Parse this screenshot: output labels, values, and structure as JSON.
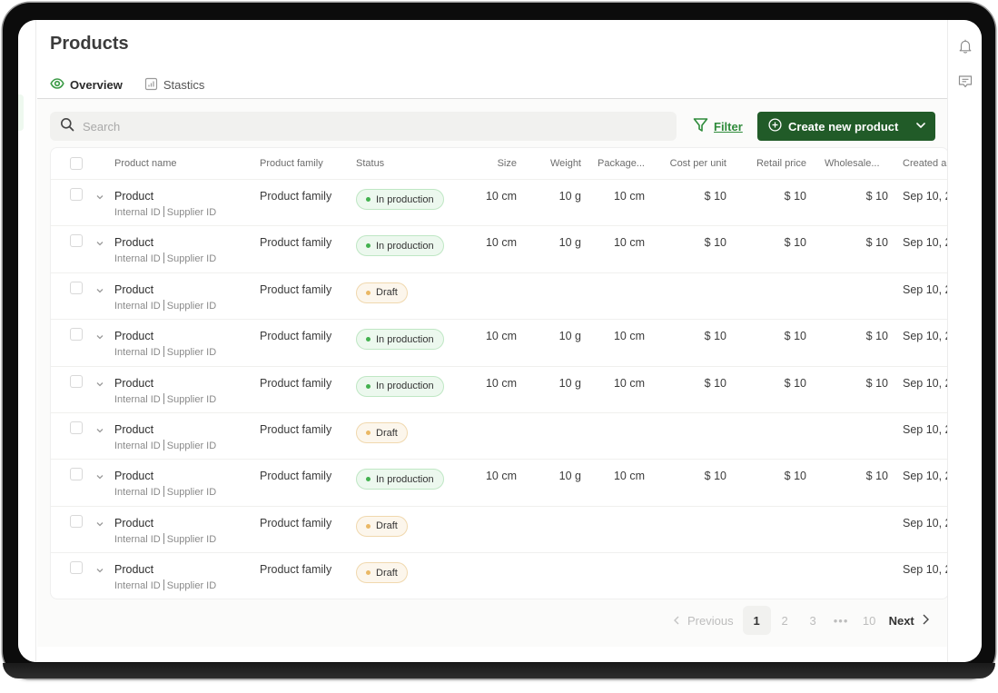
{
  "page": {
    "title": "Products"
  },
  "tabs": [
    {
      "label": "Overview",
      "icon": "eye-icon",
      "active": true
    },
    {
      "label": "Stastics",
      "icon": "bar-chart-icon",
      "active": false
    }
  ],
  "toolbar": {
    "search_placeholder": "Search",
    "search_value": "",
    "filter_label": "Filter",
    "create_label": "Create new product"
  },
  "right_rail": {
    "icons": [
      "bell-icon",
      "message-icon"
    ]
  },
  "table": {
    "columns": [
      "Product name",
      "Product family",
      "Status",
      "Size",
      "Weight",
      "Package...",
      "Cost per unit",
      "Retail price",
      "Wholesale...",
      "Created a"
    ],
    "rows": [
      {
        "name": "Product",
        "internal_id": "Internal ID",
        "supplier_id": "Supplier ID",
        "family": "Product family",
        "status": "In production",
        "size": "10 cm",
        "weight": "10 g",
        "package": "10 cm",
        "cost": "$ 10",
        "retail": "$ 10",
        "wholesale": "$ 10",
        "created": "Sep 10, 2"
      },
      {
        "name": "Product",
        "internal_id": "Internal ID",
        "supplier_id": "Supplier ID",
        "family": "Product family",
        "status": "In production",
        "size": "10 cm",
        "weight": "10 g",
        "package": "10 cm",
        "cost": "$ 10",
        "retail": "$ 10",
        "wholesale": "$ 10",
        "created": "Sep 10, 2"
      },
      {
        "name": "Product",
        "internal_id": "Internal ID",
        "supplier_id": "Supplier ID",
        "family": "Product family",
        "status": "Draft",
        "size": "",
        "weight": "",
        "package": "",
        "cost": "",
        "retail": "",
        "wholesale": "",
        "created": "Sep 10, 2"
      },
      {
        "name": "Product",
        "internal_id": "Internal ID",
        "supplier_id": "Supplier ID",
        "family": "Product family",
        "status": "In production",
        "size": "10 cm",
        "weight": "10 g",
        "package": "10 cm",
        "cost": "$ 10",
        "retail": "$ 10",
        "wholesale": "$ 10",
        "created": "Sep 10, 2"
      },
      {
        "name": "Product",
        "internal_id": "Internal ID",
        "supplier_id": "Supplier ID",
        "family": "Product family",
        "status": "In production",
        "size": "10 cm",
        "weight": "10 g",
        "package": "10 cm",
        "cost": "$ 10",
        "retail": "$ 10",
        "wholesale": "$ 10",
        "created": "Sep 10, 2"
      },
      {
        "name": "Product",
        "internal_id": "Internal ID",
        "supplier_id": "Supplier ID",
        "family": "Product family",
        "status": "Draft",
        "size": "",
        "weight": "",
        "package": "",
        "cost": "",
        "retail": "",
        "wholesale": "",
        "created": "Sep 10, 2"
      },
      {
        "name": "Product",
        "internal_id": "Internal ID",
        "supplier_id": "Supplier ID",
        "family": "Product family",
        "status": "In production",
        "size": "10 cm",
        "weight": "10 g",
        "package": "10 cm",
        "cost": "$ 10",
        "retail": "$ 10",
        "wholesale": "$ 10",
        "created": "Sep 10, 2"
      },
      {
        "name": "Product",
        "internal_id": "Internal ID",
        "supplier_id": "Supplier ID",
        "family": "Product family",
        "status": "Draft",
        "size": "",
        "weight": "",
        "package": "",
        "cost": "",
        "retail": "",
        "wholesale": "",
        "created": "Sep 10, 2"
      },
      {
        "name": "Product",
        "internal_id": "Internal ID",
        "supplier_id": "Supplier ID",
        "family": "Product family",
        "status": "Draft",
        "size": "",
        "weight": "",
        "package": "",
        "cost": "",
        "retail": "",
        "wholesale": "",
        "created": "Sep 10, 2"
      }
    ]
  },
  "pagination": {
    "previous_label": "Previous",
    "pages": [
      "1",
      "2",
      "3",
      "•••",
      "10"
    ],
    "current": "1",
    "next_label": "Next"
  },
  "colors": {
    "accent": "#3a9a45",
    "primary_button": "#215b28",
    "in_production_dot": "#42b14f",
    "draft_dot": "#eab865"
  }
}
